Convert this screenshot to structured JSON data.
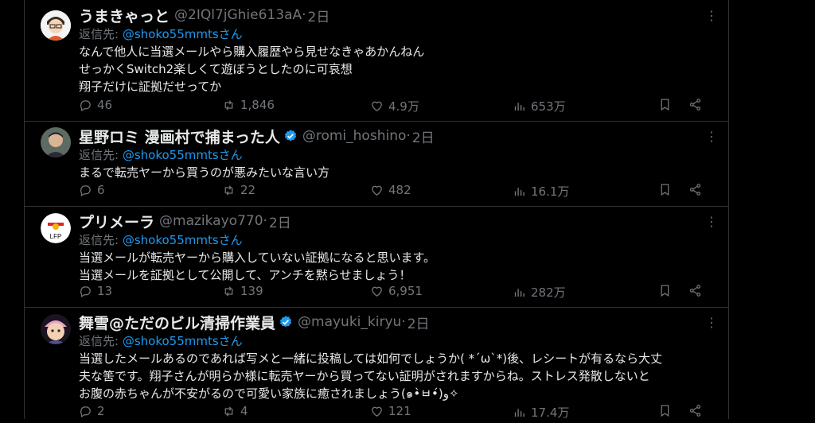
{
  "tweets": [
    {
      "name": "うまきゃっと",
      "verified": false,
      "handle": "@2IQl7jGhie613aA",
      "time": "2日",
      "reply_prefix": "返信先:",
      "reply_user": "@shoko55mmtsさん",
      "body": "なんで他人に当選メールやら購入履歴やら見せなきゃあかんねん\nせっかくSwitch2楽しくて遊ぼうとしたのに可哀想\n翔子だけに証拠だせってか",
      "replies": "46",
      "retweets": "1,846",
      "likes": "4.9万",
      "views": "653万"
    },
    {
      "name": "星野ロミ 漫画村で捕まった人",
      "verified": true,
      "handle": "@romi_hoshino",
      "time": "2日",
      "reply_prefix": "返信先:",
      "reply_user": "@shoko55mmtsさん",
      "body": "まるで転売ヤーから買うのが悪みたいな言い方",
      "replies": "6",
      "retweets": "22",
      "likes": "482",
      "views": "16.1万"
    },
    {
      "name": "プリメーラ",
      "verified": false,
      "handle": "@mazikayo770",
      "time": "2日",
      "reply_prefix": "返信先:",
      "reply_user": "@shoko55mmtsさん",
      "body": "当選メールが転売ヤーから購入していない証拠になると思います。\n当選メールを証拠として公開して、アンチを黙らせましょう！",
      "replies": "13",
      "retweets": "139",
      "likes": "6,951",
      "views": "282万"
    },
    {
      "name": "舞雪@ただのビル清掃作業員",
      "verified": true,
      "handle": "@mayuki_kiryu",
      "time": "2日",
      "reply_prefix": "返信先:",
      "reply_user": "@shoko55mmtsさん",
      "body": "当選したメールあるのであれば写メと一緒に投稿しては如何でしょうか( *´ω`*)後、レシートが有るなら大丈\n夫な筈です。翔子さんが明らか様に転売ヤーから買ってない証明がされますからね。ストレス発散しないと\nお腹の赤ちゃんが不安がるので可愛い家族に癒されましょう(๑•̀ㅂ•́)و✧",
      "replies": "2",
      "retweets": "4",
      "likes": "121",
      "views": "17.4万"
    }
  ],
  "icons": {
    "reply": "reply-icon",
    "retweet": "retweet-icon",
    "like": "heart-icon",
    "views": "views-icon",
    "bookmark": "bookmark-icon",
    "share": "share-icon",
    "more": "more-icon"
  },
  "colors": {
    "background": "#000000",
    "text": "#e7e9ea",
    "muted": "#71767b",
    "link": "#1d9bf0",
    "verified": "#1d9bf0",
    "border": "#2f3336"
  }
}
